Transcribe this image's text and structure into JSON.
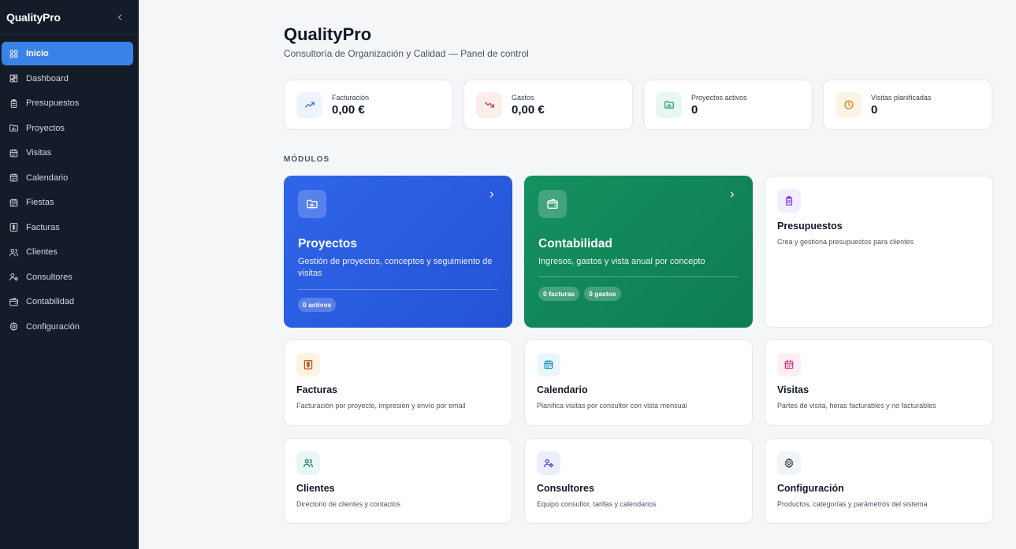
{
  "sidebar": {
    "brand": "QualityPro",
    "items": [
      {
        "label": "Inicio",
        "icon": "grid-icon"
      },
      {
        "label": "Dashboard",
        "icon": "dashboard-icon"
      },
      {
        "label": "Presupuestos",
        "icon": "clipboard-icon"
      },
      {
        "label": "Proyectos",
        "icon": "folder-icon"
      },
      {
        "label": "Visitas",
        "icon": "calendar-icon"
      },
      {
        "label": "Calendario",
        "icon": "calendar-icon"
      },
      {
        "label": "Fiestas",
        "icon": "calendar-icon"
      },
      {
        "label": "Facturas",
        "icon": "dollar-icon"
      },
      {
        "label": "Clientes",
        "icon": "users-icon"
      },
      {
        "label": "Consultores",
        "icon": "user-cog-icon"
      },
      {
        "label": "Contabilidad",
        "icon": "wallet-icon"
      },
      {
        "label": "Configuración",
        "icon": "gear-icon"
      }
    ]
  },
  "header": {
    "title": "QualityPro",
    "subtitle": "Consultoría de Organización y Calidad — Panel de control"
  },
  "stats": [
    {
      "label": "Facturación",
      "value": "0,00 €",
      "icon": "trend-up-icon",
      "color": "#2563eb",
      "bg": "#eef4ff"
    },
    {
      "label": "Gastos",
      "value": "0,00 €",
      "icon": "trend-down-icon",
      "color": "#dc2626",
      "bg": "#fdeeee"
    },
    {
      "label": "Proyectos activos",
      "value": "0",
      "icon": "folder-icon",
      "color": "#059669",
      "bg": "#e8f7f0"
    },
    {
      "label": "Visitas planificadas",
      "value": "0",
      "icon": "clock-icon",
      "color": "#d97706",
      "bg": "#fdf5e4"
    }
  ],
  "modules": {
    "section_title": "MÓDULOS",
    "featured": [
      {
        "title": "Proyectos",
        "desc": "Gestión de proyectos, conceptos y seguimiento de visitas",
        "pills": [
          "0 activos"
        ]
      },
      {
        "title": "Contabilidad",
        "desc": "Ingresos, gastos y vista anual por concepto",
        "pills": [
          "0 facturas",
          "0 gastos"
        ]
      }
    ],
    "cards": [
      {
        "title": "Presupuestos",
        "desc": "Crea y gestiona presupuestos para clientes",
        "icon": "clipboard-icon",
        "color": "#7c3aed",
        "bg": "#f3eefe"
      },
      {
        "title": "Facturas",
        "desc": "Facturación por proyecto, impresión y envío por email",
        "icon": "dollar-icon",
        "color": "#c2410c",
        "bg": "#fdf3e2"
      },
      {
        "title": "Calendario",
        "desc": "Planifica visitas por consultor con vista mensual",
        "icon": "calendar-icon",
        "color": "#0284c7",
        "bg": "#eaf6fc"
      },
      {
        "title": "Visitas",
        "desc": "Partes de visita, horas facturables y no facturables",
        "icon": "calendar-icon",
        "color": "#db2777",
        "bg": "#fdeef5"
      },
      {
        "title": "Clientes",
        "desc": "Directorio de clientes y contactos",
        "icon": "users-icon",
        "color": "#0f766e",
        "bg": "#e8f7f4"
      },
      {
        "title": "Consultores",
        "desc": "Equipo consultor, tarifas y calendarios",
        "icon": "user-cog-icon",
        "color": "#4338ca",
        "bg": "#eceefb"
      },
      {
        "title": "Configuración",
        "desc": "Productos, categorías y parámetros del sistema",
        "icon": "gear-icon",
        "color": "#374151",
        "bg": "#f3f4f6"
      }
    ]
  }
}
